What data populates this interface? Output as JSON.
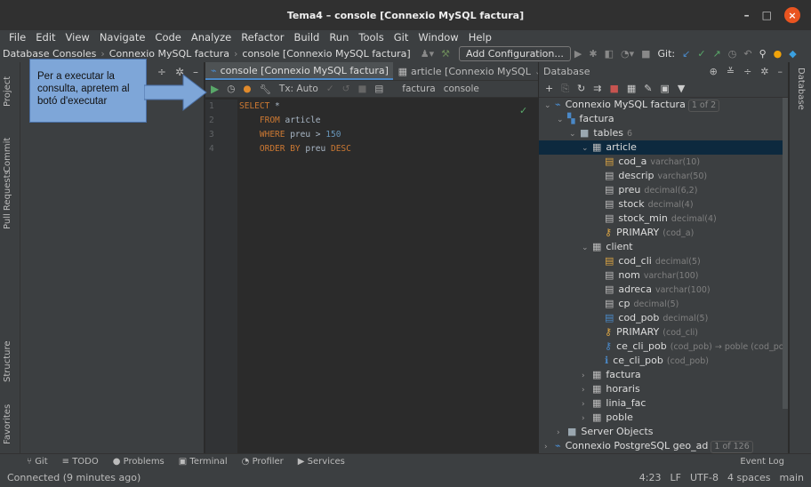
{
  "window": {
    "title": "Tema4 – console [Connexio MySQL factura]",
    "min": "–",
    "max": "□",
    "close": "×"
  },
  "menu": [
    "File",
    "Edit",
    "View",
    "Navigate",
    "Code",
    "Analyze",
    "Refactor",
    "Build",
    "Run",
    "Tools",
    "Git",
    "Window",
    "Help"
  ],
  "nav": {
    "crumbs": [
      "Database Consoles",
      "Connexio MySQL factura",
      "console [Connexio MySQL factura]"
    ],
    "add_config": "Add Configuration...",
    "git_label": "Git:"
  },
  "left_tabs": [
    "Project",
    "Commit",
    "Pull Requests",
    "Structure",
    "Favorites"
  ],
  "right_tabs": [
    "Database"
  ],
  "callout": "Per a executar la consulta, apretem al botó d'executar",
  "editor": {
    "tabs": [
      {
        "label": "console [Connexio MySQL factura]",
        "active": true
      },
      {
        "label": "article [Connexio MySQL",
        "active": false
      }
    ],
    "toolbar": {
      "tx": "Tx: Auto",
      "schema": "factura",
      "session": "console"
    },
    "line_numbers": [
      "1",
      "2",
      "3",
      "4"
    ],
    "lines": [
      [
        {
          "t": "SELECT",
          "c": "kw"
        },
        {
          "t": " *",
          "c": "plain"
        }
      ],
      [
        {
          "t": "    FROM",
          "c": "kw"
        },
        {
          "t": " article",
          "c": "plain"
        }
      ],
      [
        {
          "t": "    WHERE",
          "c": "kw"
        },
        {
          "t": " preu > ",
          "c": "plain"
        },
        {
          "t": "150",
          "c": "num"
        }
      ],
      [
        {
          "t": "    ORDER BY",
          "c": "kw"
        },
        {
          "t": " preu ",
          "c": "plain"
        },
        {
          "t": "DESC",
          "c": "kw"
        }
      ]
    ]
  },
  "db": {
    "title": "Database",
    "tree": [
      {
        "level": 0,
        "arrow": "v",
        "icon": "mysql",
        "label": "Connexio MySQL factura",
        "badge": "1 of 2"
      },
      {
        "level": 1,
        "arrow": "v",
        "icon": "schema",
        "label": "factura"
      },
      {
        "level": 2,
        "arrow": "v",
        "icon": "folder",
        "label": "tables",
        "hint": "6"
      },
      {
        "level": 3,
        "arrow": "v",
        "icon": "table",
        "label": "article",
        "selected": true
      },
      {
        "level": 4,
        "icon": "key-col",
        "label": "cod_a",
        "hint": "varchar(10)"
      },
      {
        "level": 4,
        "icon": "col",
        "label": "descrip",
        "hint": "varchar(50)"
      },
      {
        "level": 4,
        "icon": "col",
        "label": "preu",
        "hint": "decimal(6,2)"
      },
      {
        "level": 4,
        "icon": "col",
        "label": "stock",
        "hint": "decimal(4)"
      },
      {
        "level": 4,
        "icon": "col",
        "label": "stock_min",
        "hint": "decimal(4)"
      },
      {
        "level": 4,
        "icon": "pk",
        "label": "PRIMARY",
        "hint": "(cod_a)"
      },
      {
        "level": 3,
        "arrow": "v",
        "icon": "table",
        "label": "client"
      },
      {
        "level": 4,
        "icon": "key-col",
        "label": "cod_cli",
        "hint": "decimal(5)"
      },
      {
        "level": 4,
        "icon": "col",
        "label": "nom",
        "hint": "varchar(100)"
      },
      {
        "level": 4,
        "icon": "col",
        "label": "adreca",
        "hint": "varchar(100)"
      },
      {
        "level": 4,
        "icon": "col",
        "label": "cp",
        "hint": "decimal(5)"
      },
      {
        "level": 4,
        "icon": "fk-col",
        "label": "cod_pob",
        "hint": "decimal(5)"
      },
      {
        "level": 4,
        "icon": "pk",
        "label": "PRIMARY",
        "hint": "(cod_cli)"
      },
      {
        "level": 4,
        "icon": "fk",
        "label": "ce_cli_pob",
        "hint": "(cod_pob) → poble (cod_pob)"
      },
      {
        "level": 4,
        "icon": "index",
        "label": "ce_cli_pob",
        "hint": "(cod_pob)"
      },
      {
        "level": 3,
        "arrow": ">",
        "icon": "table",
        "label": "factura"
      },
      {
        "level": 3,
        "arrow": ">",
        "icon": "table",
        "label": "horaris"
      },
      {
        "level": 3,
        "arrow": ">",
        "icon": "table",
        "label": "linia_fac"
      },
      {
        "level": 3,
        "arrow": ">",
        "icon": "table",
        "label": "poble"
      },
      {
        "level": 1,
        "arrow": ">",
        "icon": "folder",
        "label": "Server Objects"
      },
      {
        "level": 0,
        "arrow": ">",
        "icon": "postgres",
        "label": "Connexio PostgreSQL geo_ad",
        "badge": "1 of 126"
      }
    ]
  },
  "bottom_tools": [
    "Git",
    "TODO",
    "Problems",
    "Terminal",
    "Profiler",
    "Services"
  ],
  "event_log": "Event Log",
  "status": {
    "message": "Connected (9 minutes ago)",
    "position": "4:23",
    "line_ending": "LF",
    "encoding": "UTF-8",
    "indent": "4 spaces",
    "branch": "main"
  },
  "colors": {
    "accent": "#4a88c7",
    "run": "#59a869",
    "callout": "#7ea6d8"
  }
}
